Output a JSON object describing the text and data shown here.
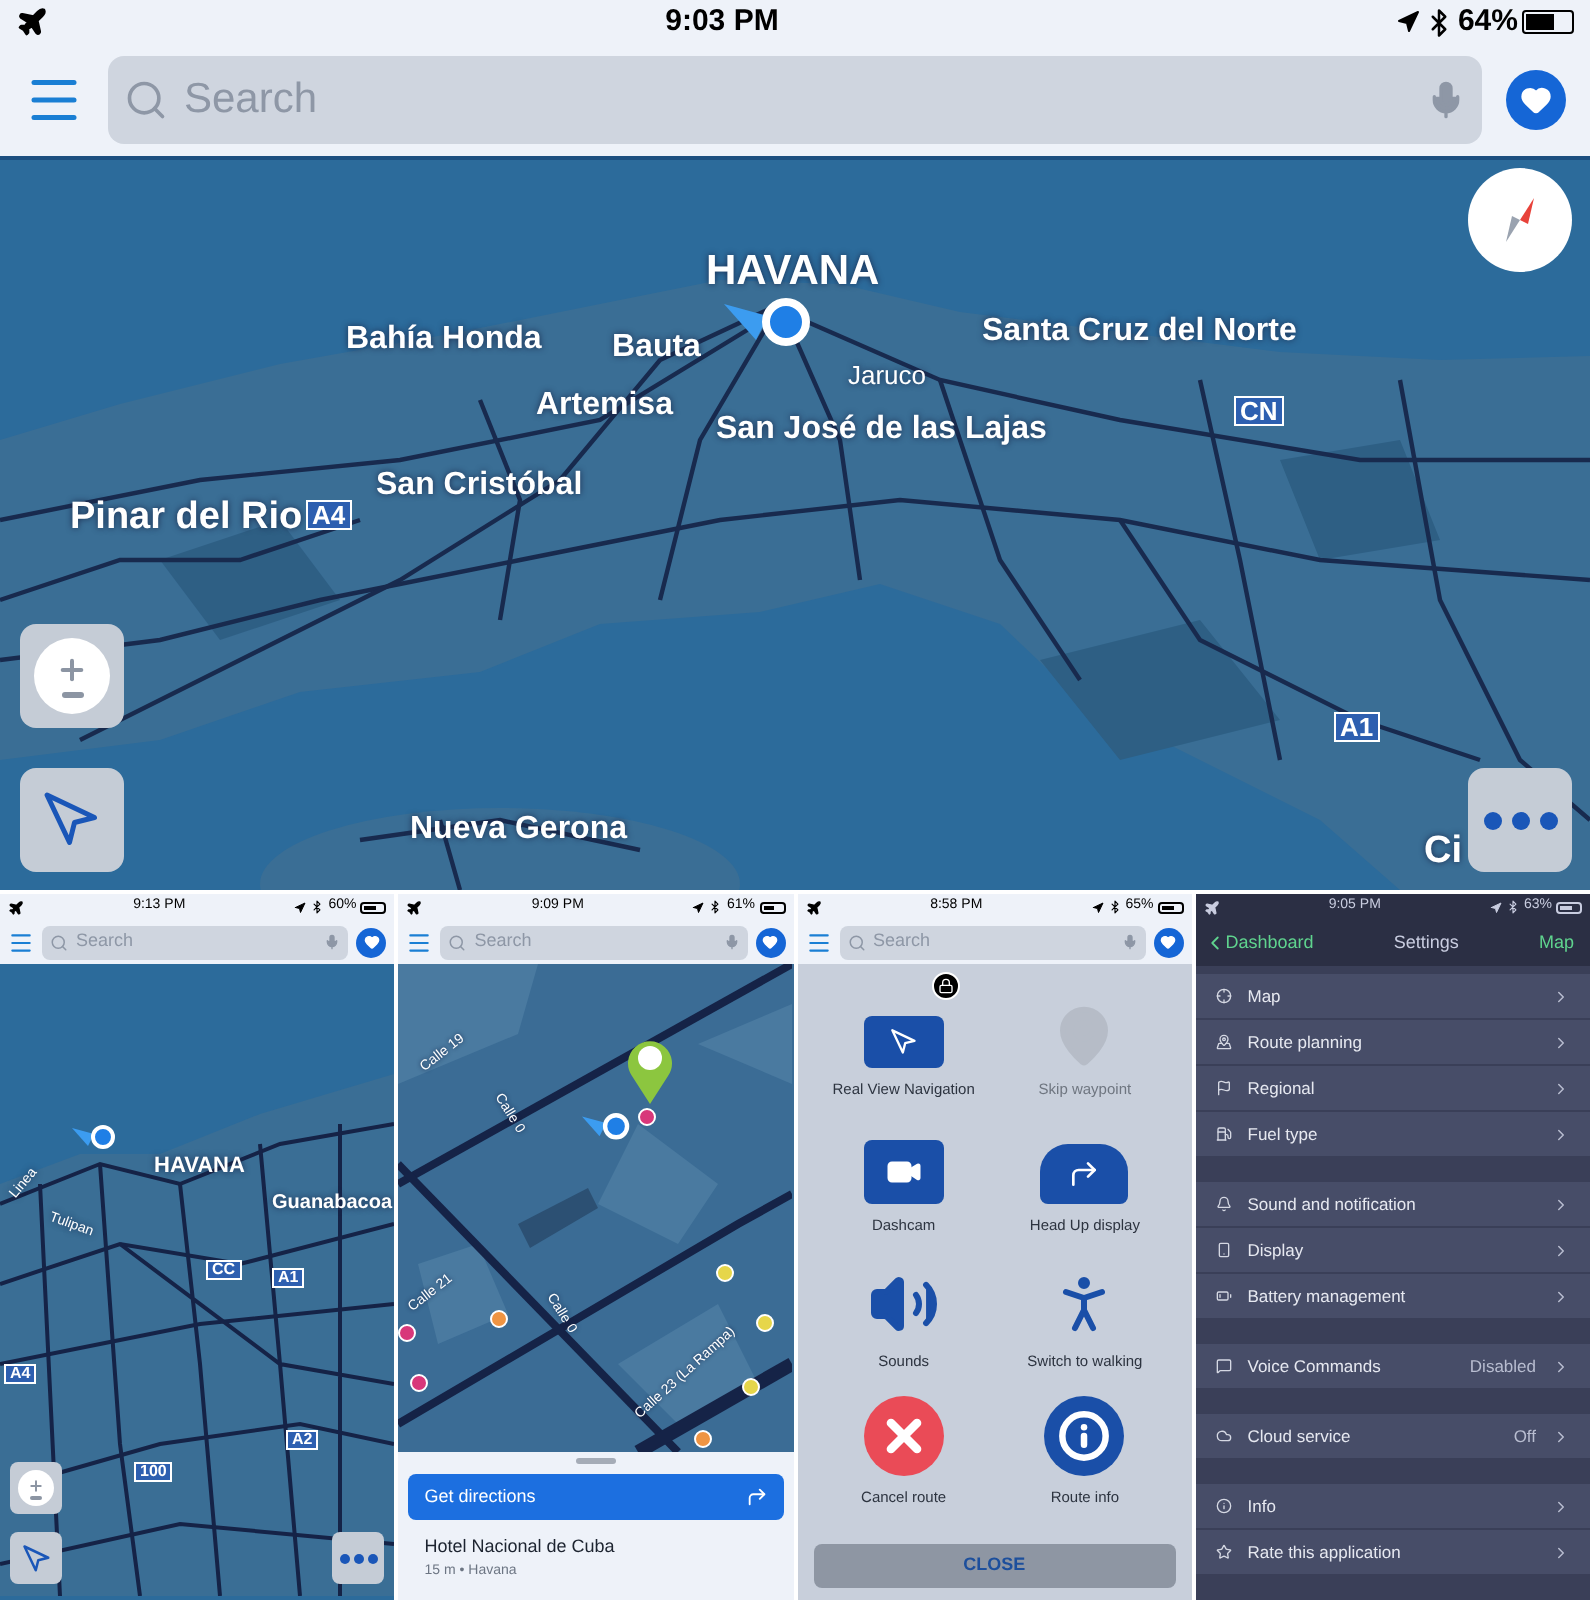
{
  "main": {
    "status_bar": {
      "time": "9:03 PM",
      "battery": "64%"
    },
    "search": {
      "placeholder": "Search"
    },
    "map_labels": [
      {
        "text": "HAVANA",
        "kind": "capital"
      },
      {
        "text": "Bahía Honda",
        "kind": "city"
      },
      {
        "text": "Bauta",
        "kind": "city"
      },
      {
        "text": "Santa Cruz del Norte",
        "kind": "city"
      },
      {
        "text": "Jaruco",
        "kind": "town"
      },
      {
        "text": "Artemisa",
        "kind": "city"
      },
      {
        "text": "San José de las Lajas",
        "kind": "city"
      },
      {
        "text": "CN",
        "kind": "shield"
      },
      {
        "text": "San Cristóbal",
        "kind": "city"
      },
      {
        "text": "Pinar del Rio",
        "kind": "major"
      },
      {
        "text": "A4",
        "kind": "shield"
      },
      {
        "text": "A1",
        "kind": "shield"
      },
      {
        "text": "Nueva Gerona",
        "kind": "city"
      },
      {
        "text": "Ci",
        "kind": "major"
      }
    ]
  },
  "panels": [
    {
      "kind": "overview_map",
      "status_bar": {
        "time": "9:13 PM",
        "battery": "60%"
      },
      "search": {
        "placeholder": "Search"
      },
      "map_labels": [
        {
          "text": "HAVANA",
          "kind": "capital"
        },
        {
          "text": "Guanabacoa",
          "kind": "city"
        },
        {
          "text": "CC",
          "kind": "shield"
        },
        {
          "text": "A1",
          "kind": "shield"
        },
        {
          "text": "A4",
          "kind": "shield"
        },
        {
          "text": "A2",
          "kind": "shield"
        },
        {
          "text": "100",
          "kind": "shield"
        },
        {
          "text": "Linea",
          "kind": "street"
        },
        {
          "text": "Tulipan",
          "kind": "street"
        }
      ]
    },
    {
      "kind": "place_map",
      "status_bar": {
        "time": "9:09 PM",
        "battery": "61%"
      },
      "search": {
        "placeholder": "Search"
      },
      "street_labels": [
        "Calle 19",
        "Calle 21",
        "Calle 0",
        "Calle 0",
        "Calle 23 (La Rampa)"
      ],
      "action": "Get directions",
      "place": {
        "name": "Hotel Nacional de Cuba",
        "details": "15 m • Havana"
      }
    },
    {
      "kind": "menu",
      "status_bar": {
        "time": "8:58 PM",
        "battery": "65%"
      },
      "search": {
        "placeholder": "Search"
      },
      "actions": [
        {
          "label": "Real View Navigation",
          "disabled": false,
          "locked": true
        },
        {
          "label": "Skip waypoint",
          "disabled": true,
          "locked": false
        },
        {
          "label": "Dashcam",
          "disabled": false,
          "locked": false
        },
        {
          "label": "Head Up display",
          "disabled": false,
          "locked": false
        },
        {
          "label": "Sounds",
          "disabled": false,
          "locked": false
        },
        {
          "label": "Switch to walking",
          "disabled": false,
          "locked": false
        },
        {
          "label": "Cancel route",
          "disabled": false,
          "locked": false
        },
        {
          "label": "Route info",
          "disabled": false,
          "locked": false
        }
      ],
      "close": "CLOSE"
    },
    {
      "kind": "settings",
      "status_bar": {
        "time": "9:05 PM",
        "battery": "63%"
      },
      "nav": {
        "back": "Dashboard",
        "title": "Settings",
        "right": "Map"
      },
      "groups": [
        {
          "items": [
            {
              "label": "Map"
            },
            {
              "label": "Route planning"
            },
            {
              "label": "Regional"
            },
            {
              "label": "Fuel type"
            }
          ]
        },
        {
          "items": [
            {
              "label": "Sound and notification"
            },
            {
              "label": "Display"
            },
            {
              "label": "Battery management"
            }
          ]
        },
        {
          "items": [
            {
              "label": "Voice Commands",
              "value": "Disabled"
            }
          ]
        },
        {
          "items": [
            {
              "label": "Cloud service",
              "value": "Off"
            }
          ]
        },
        {
          "items": [
            {
              "label": "Info"
            },
            {
              "label": "Rate this application"
            }
          ]
        }
      ]
    }
  ]
}
